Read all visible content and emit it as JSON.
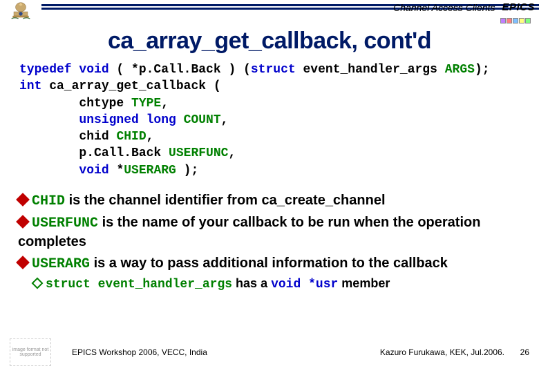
{
  "header": {
    "section_label": "Channel Access Clients",
    "brand": "EPICS"
  },
  "title": "ca_array_get_callback, cont'd",
  "code": {
    "l1a": "typedef void",
    "l1b": " ( *p.Call.Back ) (",
    "l1c": "struct",
    "l1d": " event_handler_args ",
    "l1e": "ARGS",
    "l1f": ");",
    "l2a": "int",
    "l2b": " ca_array_get_callback (",
    "l3a": "        chtype ",
    "l3b": "TYPE",
    "l3c": ",",
    "l4a": "        unsigned long",
    "l4b": " COUNT",
    "l4c": ",",
    "l5a": "        chid ",
    "l5b": "CHID",
    "l5c": ",",
    "l6a": "        p.Call.Back ",
    "l6b": "USERFUNC",
    "l6c": ",",
    "l7a": "        ",
    "l7b": "void",
    "l7c": " *",
    "l7d": "USERARG",
    "l7e": " );"
  },
  "bullets": {
    "b1_code": "CHID",
    "b1_text": " is the channel identifier from ca_create_channel",
    "b2_code": "USERFUNC",
    "b2_text": " is the name of your callback to be run when the operation completes",
    "b3_code": "USERARG",
    "b3_text": " is a way to pass additional information to the callback",
    "sub_a": "struct event_handler_args",
    "sub_mid": " has a ",
    "sub_b": "void *usr",
    "sub_end": " member"
  },
  "footer": {
    "left": "EPICS Workshop 2006, VECC, India",
    "right": "Kazuro Furukawa, KEK, Jul.2006.",
    "page": "26",
    "img_alt": "image format not supported"
  }
}
